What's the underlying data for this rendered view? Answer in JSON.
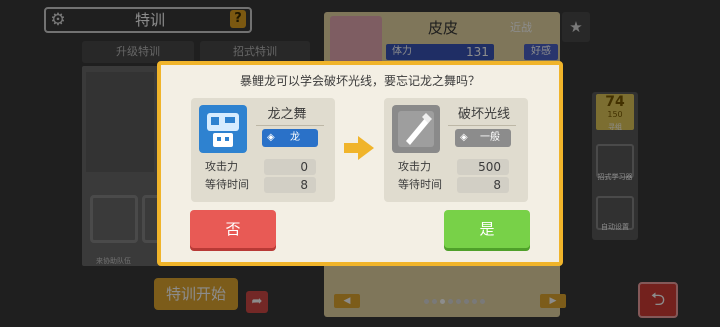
{
  "header": {
    "title": "特训",
    "help_label": "?"
  },
  "tabs": [
    {
      "label": "升级特训"
    },
    {
      "label": "招式特训"
    }
  ],
  "left_panel": {
    "bottom_hint": "来协助队伍"
  },
  "train_button_label": "特训开始",
  "pokemon": {
    "name": "皮皮",
    "near_label": "近战",
    "fav_label": "好感",
    "hp_label": "体力",
    "hp_value": "131"
  },
  "side": {
    "count_current": "74",
    "count_total": "150",
    "label_owned": "寻组",
    "label_learn": "招式学习器",
    "label_auto": "自动设置"
  },
  "dialog": {
    "question": "暴鲤龙可以学会破坏光线，要忘记龙之舞吗？",
    "stat_labels": {
      "attack": "攻击力",
      "wait": "等待时间"
    },
    "current_move": {
      "name": "龙之舞",
      "type": "龙",
      "type_color": "#2a71c8",
      "attack": "0",
      "wait": "8"
    },
    "new_move": {
      "name": "破坏光线",
      "type": "一般",
      "type_color": "#8c8c8c",
      "attack": "500",
      "wait": "8"
    },
    "no_label": "否",
    "yes_label": "是"
  },
  "colors": {
    "accent": "#f0b42a",
    "no": "#e85a55",
    "yes": "#78d148"
  }
}
